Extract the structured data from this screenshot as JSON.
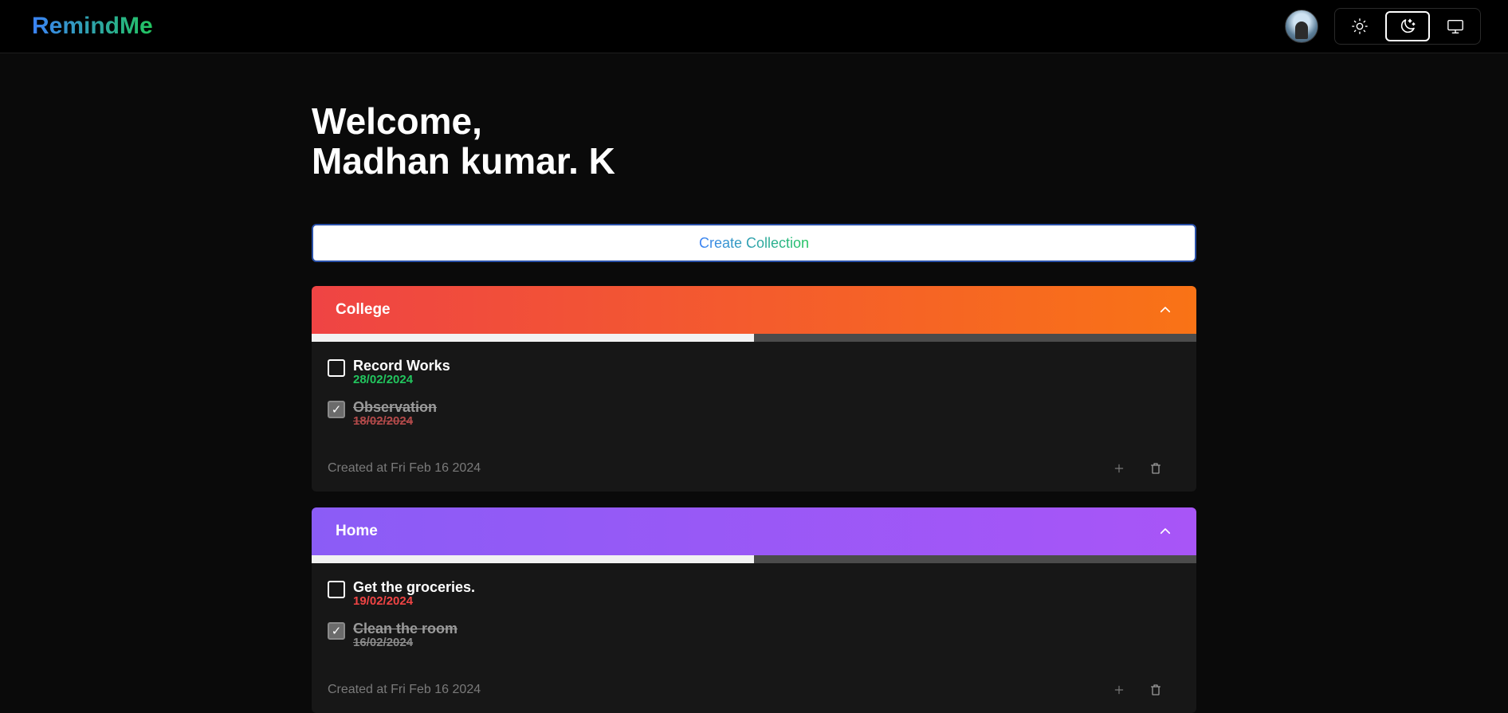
{
  "app": {
    "logo": "RemindMe"
  },
  "theme": {
    "options": [
      "light",
      "dark",
      "system"
    ],
    "active": "dark"
  },
  "welcome": {
    "line1": "Welcome,",
    "line2": "Madhan kumar. K"
  },
  "create_button": "Create Collection",
  "collections": [
    {
      "name": "College",
      "gradient": [
        "#ef4444",
        "#f97316"
      ],
      "progress": 0.5,
      "tasks": [
        {
          "title": "Record Works",
          "date": "28/02/2024",
          "done": false,
          "date_color": "#22c55e"
        },
        {
          "title": "Observation",
          "date": "18/02/2024",
          "done": true,
          "date_color": "#b34a4a"
        }
      ],
      "created": "Created at Fri Feb 16 2024"
    },
    {
      "name": "Home",
      "gradient": [
        "#8b5cf6",
        "#a855f7"
      ],
      "progress": 0.5,
      "tasks": [
        {
          "title": "Get the groceries.",
          "date": "19/02/2024",
          "done": false,
          "date_color": "#ef4444"
        },
        {
          "title": "Clean the room",
          "date": "16/02/2024",
          "done": true,
          "date_color": "#8a8a8a"
        }
      ],
      "created": "Created at Fri Feb 16 2024"
    }
  ]
}
